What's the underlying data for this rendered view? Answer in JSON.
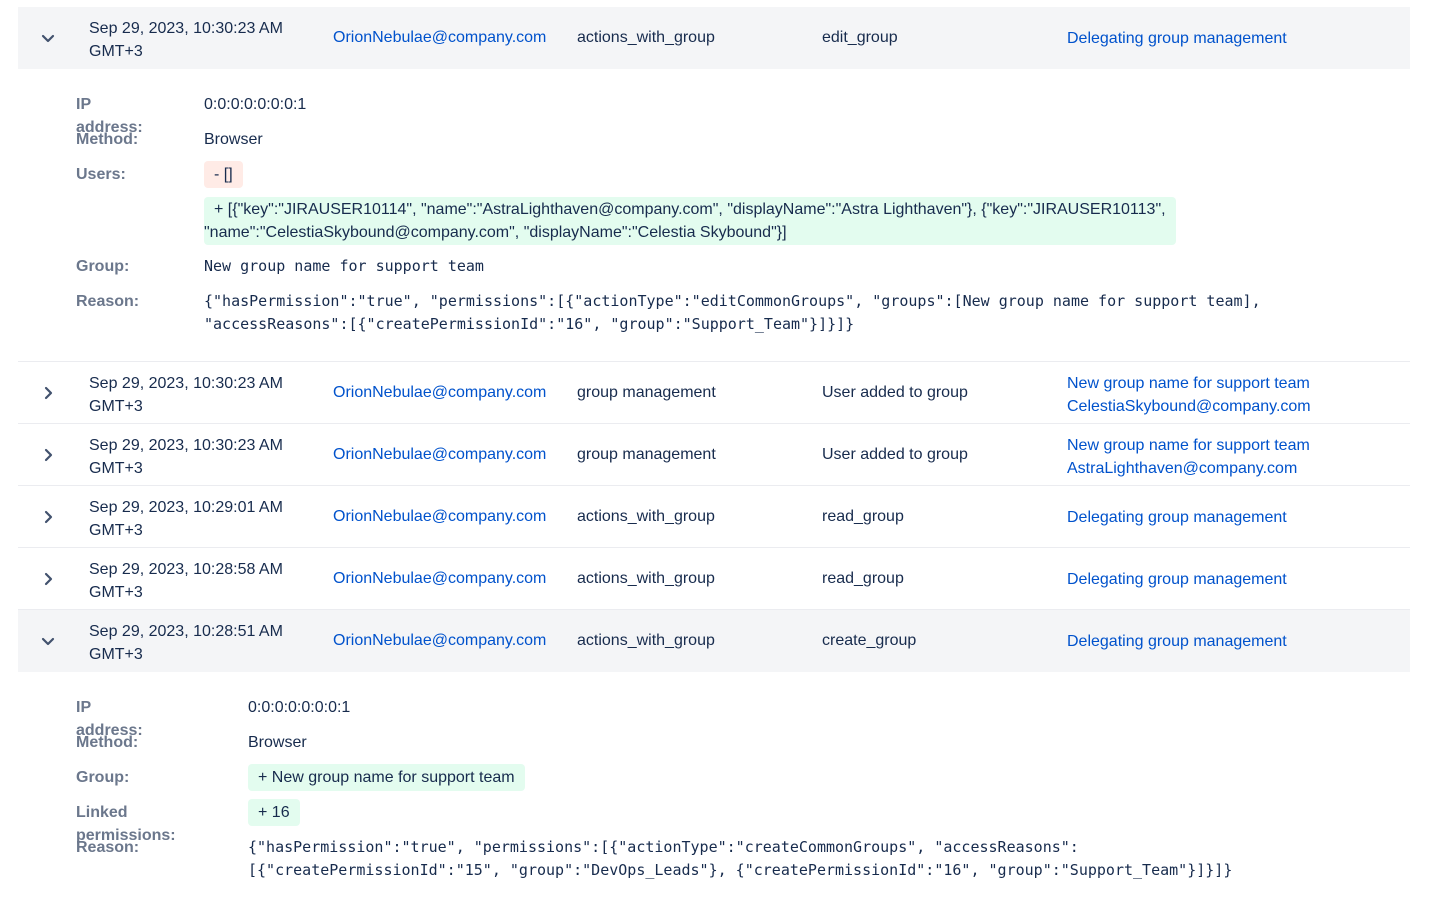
{
  "labels": {
    "ip": "IP address:",
    "method": "Method:",
    "users": "Users:",
    "group": "Group:",
    "reason": "Reason:",
    "linked": "Linked permissions:"
  },
  "rows": [
    {
      "date": "Sep 29, 2023, 10:30:23 AM",
      "tz": "GMT+3",
      "user": "OrionNebulae@company.com",
      "category": "actions_with_group",
      "action": "edit_group",
      "object": [
        "Delegating group management"
      ]
    },
    {
      "date": "Sep 29, 2023, 10:30:23 AM",
      "tz": "GMT+3",
      "user": "OrionNebulae@company.com",
      "category": "group management",
      "action": "User added to group",
      "object": [
        "New group name for support team",
        "CelestiaSkybound@company.com"
      ]
    },
    {
      "date": "Sep 29, 2023, 10:30:23 AM",
      "tz": "GMT+3",
      "user": "OrionNebulae@company.com",
      "category": "group management",
      "action": "User added to group",
      "object": [
        "New group name for support team",
        "AstraLighthaven@company.com"
      ]
    },
    {
      "date": "Sep 29, 2023, 10:29:01 AM",
      "tz": "GMT+3",
      "user": "OrionNebulae@company.com",
      "category": "actions_with_group",
      "action": "read_group",
      "object": [
        "Delegating group management"
      ]
    },
    {
      "date": "Sep 29, 2023, 10:28:58 AM",
      "tz": "GMT+3",
      "user": "OrionNebulae@company.com",
      "category": "actions_with_group",
      "action": "read_group",
      "object": [
        "Delegating group management"
      ]
    },
    {
      "date": "Sep 29, 2023, 10:28:51 AM",
      "tz": "GMT+3",
      "user": "OrionNebulae@company.com",
      "category": "actions_with_group",
      "action": "create_group",
      "object": [
        "Delegating group management"
      ]
    }
  ],
  "details1": {
    "ip": "0:0:0:0:0:0:0:1",
    "method": "Browser",
    "users_removed": "- []",
    "users_added_line1": "+ [{\"key\":\"JIRAUSER10114\", \"name\":\"AstraLighthaven@company.com\", \"displayName\":\"Astra Lighthaven\"}, {\"key\":\"JIRAUSER10113\",",
    "users_added_line2": "\"name\":\"CelestiaSkybound@company.com\", \"displayName\":\"Celestia Skybound\"}]",
    "group": "New group name for support team",
    "reason_line1": "{\"hasPermission\":\"true\", \"permissions\":[{\"actionType\":\"editCommonGroups\", \"groups\":[New group name for support team],",
    "reason_line2": "\"accessReasons\":[{\"createPermissionId\":\"16\", \"group\":\"Support_Team\"}]}]}"
  },
  "details2": {
    "ip": "0:0:0:0:0:0:0:1",
    "method": "Browser",
    "group_added": "+ New group name for support team",
    "linked_added": "+ 16",
    "reason_line1": "{\"hasPermission\":\"true\", \"permissions\":[{\"actionType\":\"createCommonGroups\", \"accessReasons\":",
    "reason_line2": "[{\"createPermissionId\":\"15\", \"group\":\"DevOps_Leads\"}, {\"createPermissionId\":\"16\", \"group\":\"Support_Team\"}]}]}"
  },
  "colors": {
    "link": "#0052cc",
    "text": "#172b4d",
    "label": "#6b778c",
    "expanded_bg": "#f4f5f7",
    "removed_bg": "#ffebe6",
    "added_bg": "#e3fcef"
  },
  "icons": {
    "expanded": "chevron-down-icon",
    "collapsed": "chevron-right-icon"
  }
}
